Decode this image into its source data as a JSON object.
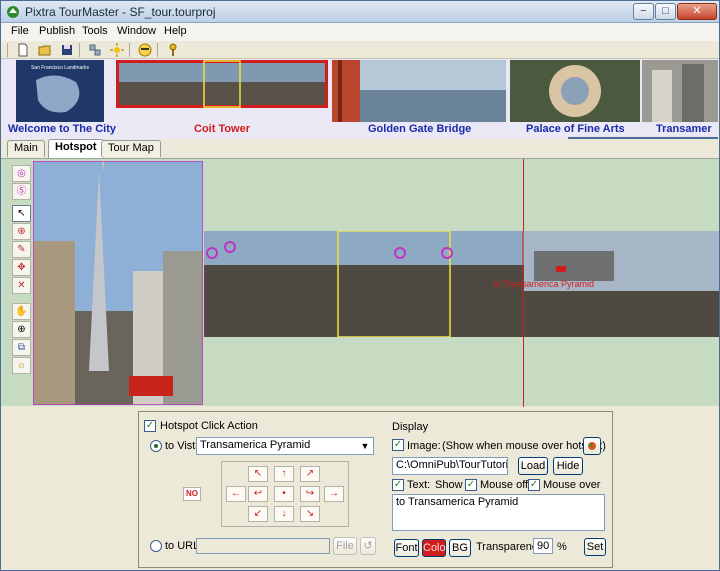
{
  "window": {
    "title": "Pixtra TourMaster - SF_tour.tourproj",
    "minimize_glyph": "−",
    "maximize_glyph": "□",
    "close_glyph": "✕"
  },
  "menu": [
    "File",
    "Publish",
    "Tools",
    "Window",
    "Help"
  ],
  "toolbar": {
    "icons": [
      "new-file-icon",
      "open-folder-icon",
      "save-icon",
      "cut-icon",
      "settings-sun-icon",
      "smiley-icon",
      "key-icon"
    ]
  },
  "thumbnails": {
    "map_title": "San Francisco Landmarks",
    "items": [
      {
        "label": "Welcome to The City",
        "color": "#1a2aa8"
      },
      {
        "label": "Coit Tower",
        "color": "#d21c1c"
      },
      {
        "label": "Golden Gate Bridge",
        "color": "#1a2aa8"
      },
      {
        "label": "Palace of Fine Arts",
        "color": "#1a2aa8"
      },
      {
        "label": "Transamer",
        "color": "#1a2aa8"
      }
    ]
  },
  "tabs": [
    "Main",
    "Hotspot",
    "Tour Map"
  ],
  "active_tab": "Hotspot",
  "left_tools": [
    "hotspot-circle-icon",
    "hotspot-s-icon",
    "pointer-icon",
    "zoom-icon",
    "brush-icon",
    "move-icon",
    "delete-x-icon",
    "hand-icon",
    "magnifier-icon",
    "resize-icon",
    "light-icon"
  ],
  "panorama": {
    "hotspot_text": "to Transamerica Pyramid"
  },
  "hotspot": {
    "click_action_label": "Hotspot Click Action",
    "click_action_checked": true,
    "to_vista_label": "to Vista",
    "vista_value": "Transamerica Pyramid",
    "to_url_label": "to URL",
    "url_value": "",
    "file_button": "File",
    "refresh_glyph": "↺",
    "no_badge": "NO"
  },
  "display": {
    "heading": "Display",
    "image_label": "Image:",
    "image_hint": "(Show when mouse over hotspot)",
    "image_checked": true,
    "image_path": "C:\\OmniPub\\TourTutorial\\SF",
    "load_button": "Load",
    "hide_button": "Hide",
    "text_label": "Text:",
    "show_label": "Show",
    "mouse_off_label": "Mouse off",
    "mouse_over_label": "Mouse over",
    "text_checked": true,
    "mouse_off_checked": true,
    "mouse_over_checked": true,
    "text_value": "to Transamerica Pyramid",
    "font_button": "Font",
    "color_button": "Color",
    "bg_button": "BG",
    "transparency_label": "Transparency",
    "transparency_value": "90",
    "percent_label": "%",
    "set_button": "Set",
    "accent_color": "#d21c1c"
  }
}
